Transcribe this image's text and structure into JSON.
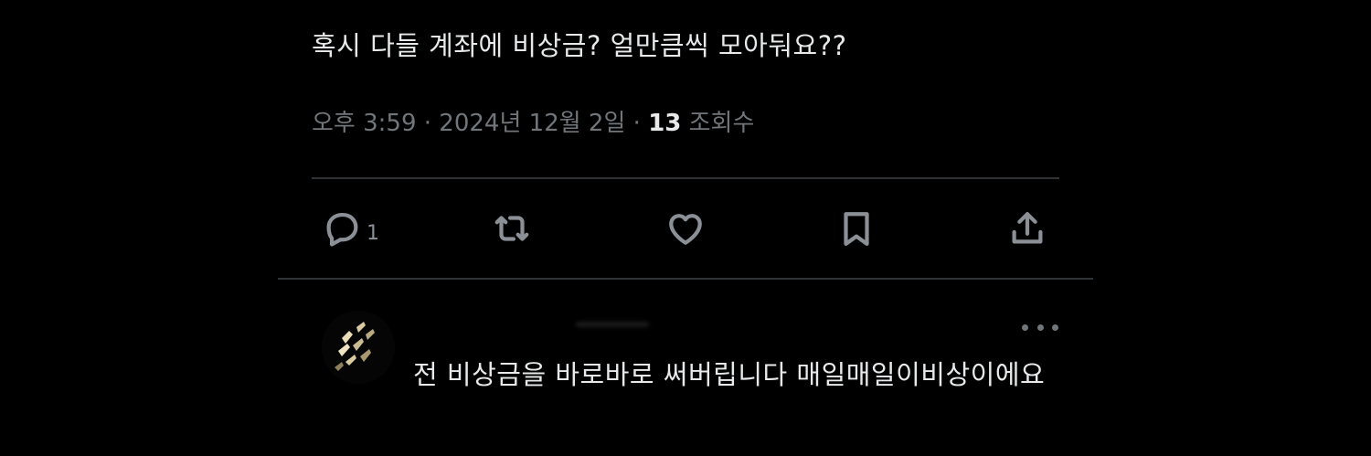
{
  "tweet": {
    "text": "혹시 다들 계좌에 비상금? 얼만큼씩 모아둬요??",
    "time": "오후 3:59",
    "separator": " · ",
    "date": "2024년 12월 2일",
    "views_count": "13",
    "views_label": " 조회수"
  },
  "actions": {
    "reply_icon": "reply-icon",
    "reply_count": "1",
    "retweet_icon": "retweet-icon",
    "like_icon": "heart-icon",
    "bookmark_icon": "bookmark-icon",
    "share_icon": "share-icon"
  },
  "reply": {
    "text": "전 비상금을 바로바로 써버립니다 매일매일이비상이에요",
    "more_icon": "more-dots-icon"
  },
  "colors": {
    "background": "#000000",
    "text_primary": "#e7e9ea",
    "text_secondary": "#71767b",
    "divider": "#2f3336"
  }
}
